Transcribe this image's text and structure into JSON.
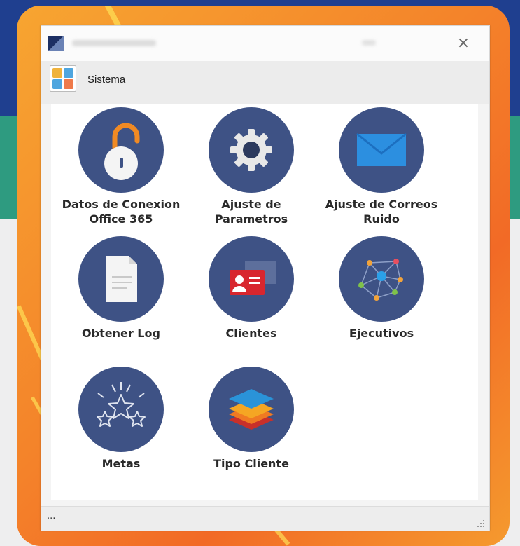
{
  "window": {
    "close_glyph": "×",
    "section_title": "Sistema",
    "status_text": "..."
  },
  "tiles": [
    {
      "label": "Datos de Conexion\nOffice 365",
      "icon": "padlock-icon"
    },
    {
      "label": "Ajuste de\nParametros",
      "icon": "gear-icon"
    },
    {
      "label": "Ajuste de Correos\nRuido",
      "icon": "envelope-icon"
    },
    {
      "label": "Obtener Log",
      "icon": "document-icon"
    },
    {
      "label": "Clientes",
      "icon": "contact-card-icon"
    },
    {
      "label": "Ejecutivos",
      "icon": "network-icon"
    },
    {
      "label": "Metas",
      "icon": "stars-icon"
    },
    {
      "label": "Tipo Cliente",
      "icon": "layers-icon"
    }
  ],
  "colors": {
    "tile_circle": "#3e5285",
    "frame_orange": "#f4832a",
    "band_blue": "#1f3f8f",
    "band_green": "#2e9b80"
  }
}
